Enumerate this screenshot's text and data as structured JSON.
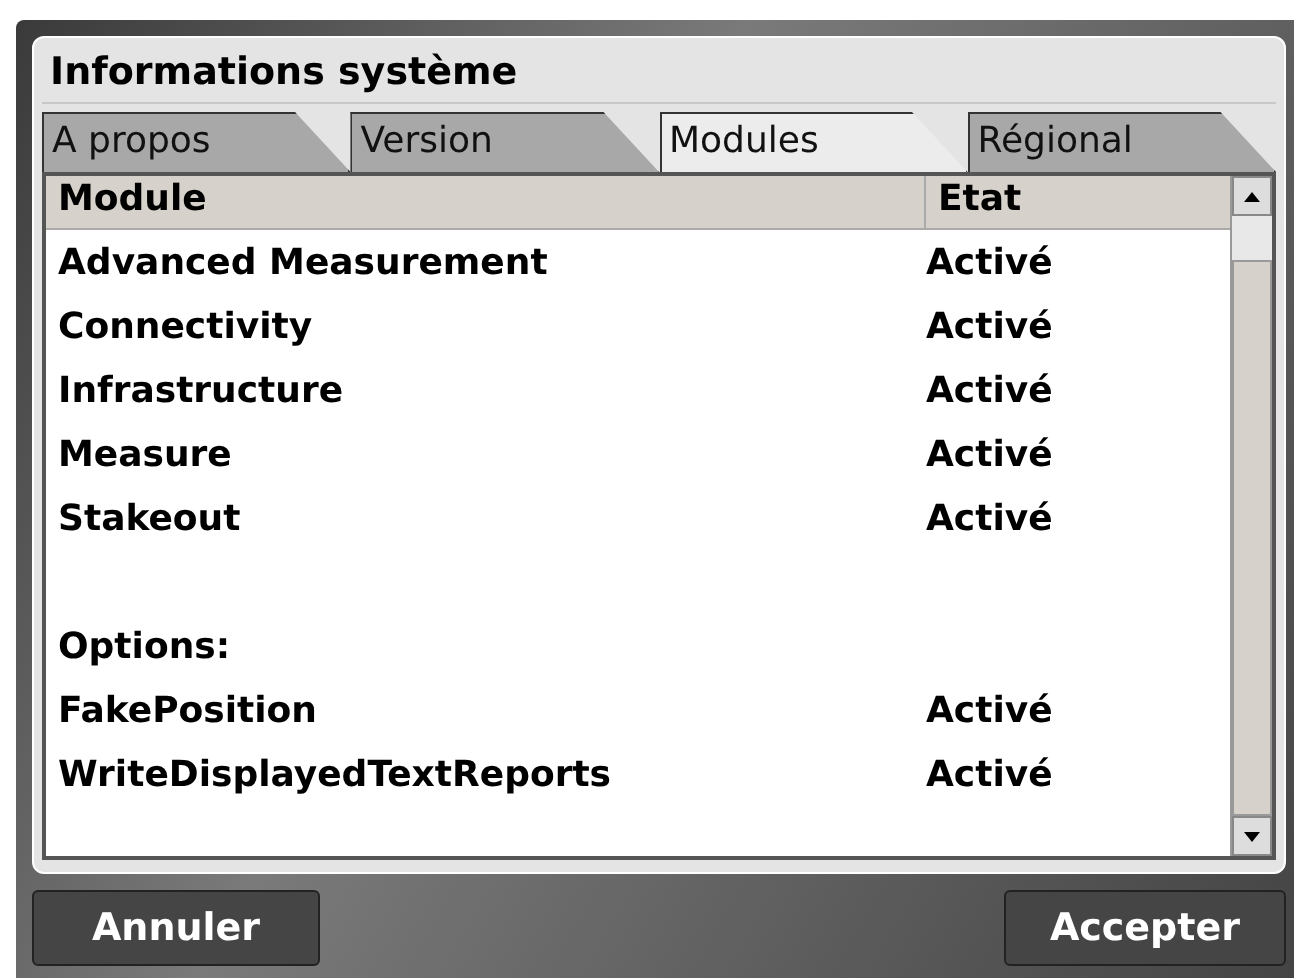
{
  "window": {
    "title": "Informations système"
  },
  "tabs": [
    {
      "label": "A propos",
      "selected": false
    },
    {
      "label": "Version",
      "selected": false
    },
    {
      "label": "Modules",
      "selected": true
    },
    {
      "label": "Régional",
      "selected": false
    }
  ],
  "table": {
    "columns": [
      "Module",
      "Etat"
    ],
    "rows": [
      {
        "kind": "item",
        "module": "Advanced Measurement",
        "state": "Activé"
      },
      {
        "kind": "item",
        "module": "Connectivity",
        "state": "Activé"
      },
      {
        "kind": "item",
        "module": "Infrastructure",
        "state": "Activé"
      },
      {
        "kind": "item",
        "module": "Measure",
        "state": "Activé"
      },
      {
        "kind": "item",
        "module": "Stakeout",
        "state": "Activé"
      },
      {
        "kind": "section",
        "module": "Options:"
      },
      {
        "kind": "item",
        "module": "FakePosition",
        "state": "Activé"
      },
      {
        "kind": "item",
        "module": "WriteDisplayedTextReports",
        "state": "Activé"
      }
    ]
  },
  "buttons": [
    "Annuler",
    "Accepter"
  ]
}
